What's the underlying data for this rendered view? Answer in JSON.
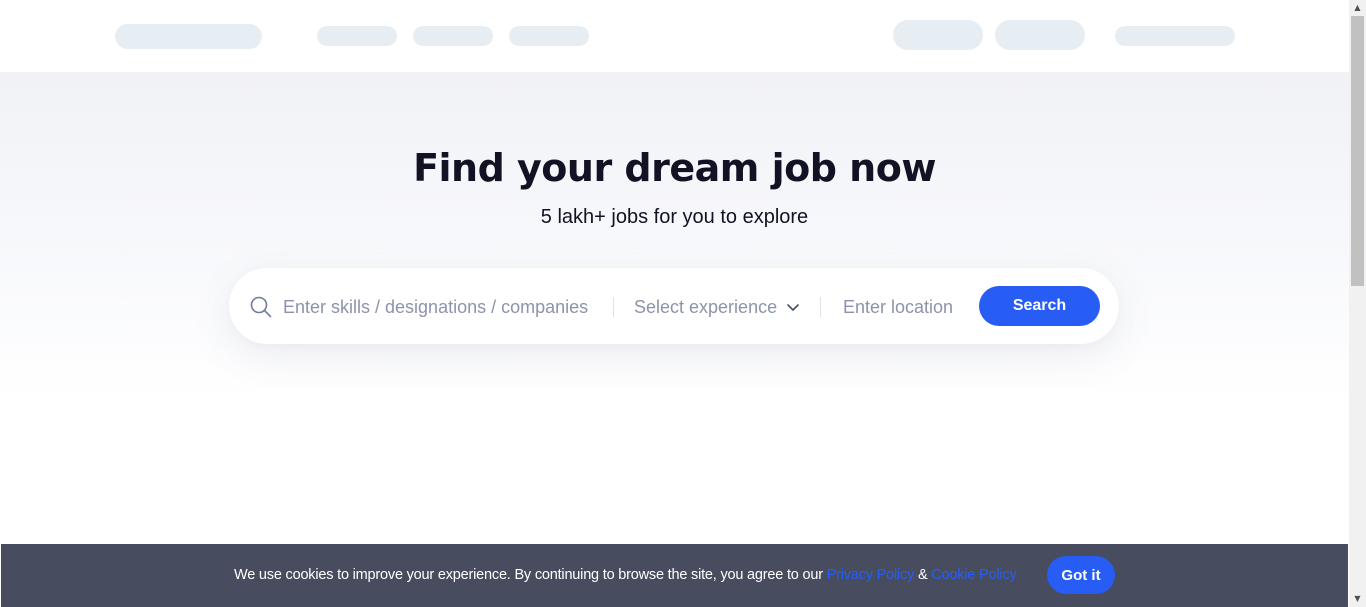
{
  "hero": {
    "title": "Find your dream job now",
    "subtitle": "5 lakh+ jobs for you to explore"
  },
  "search": {
    "skills_placeholder": "Enter skills / designations / companies",
    "experience_label": "Select experience",
    "location_placeholder": "Enter location",
    "button_label": "Search"
  },
  "cookie_banner": {
    "text": "We use cookies to improve your experience. By continuing to browse the site, you agree to our ",
    "privacy_link": "Privacy Policy",
    "separator": " & ",
    "cookie_link": "Cookie Policy",
    "button_label": "Got it"
  },
  "scrollbar": {
    "up_arrow": "▲",
    "down_arrow": "▼"
  },
  "colors": {
    "accent": "#275df5",
    "title": "#121224",
    "placeholder": "#8d93aa",
    "banner_bg": "#474d5e",
    "skeleton": "#e7eef3"
  },
  "icons": {
    "search": "search-icon",
    "dropdown": "chevron-down-icon"
  }
}
